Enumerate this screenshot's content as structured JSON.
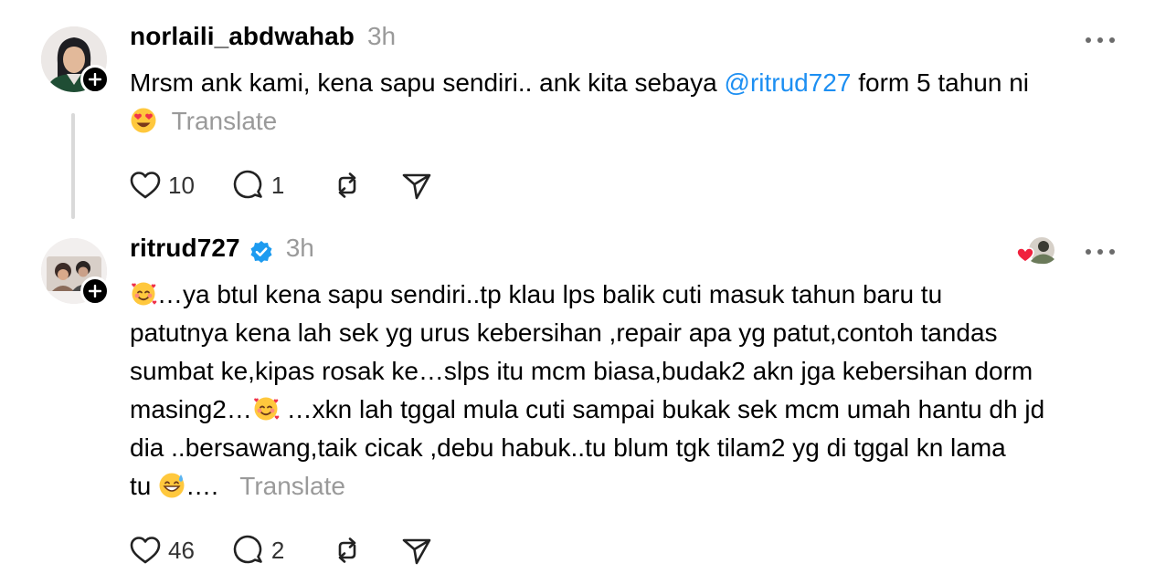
{
  "posts": [
    {
      "username": "norlaili_abdwahab",
      "time": "3h",
      "text_before_mention": "Mrsm ank kami, kena sapu sendiri.. ank kita sebaya ",
      "mention": "@ritrud727",
      "text_after_mention": " form 5 tahun ni",
      "emoji_icon": "heart-eyes-emoji",
      "translate_label": "Translate",
      "likes": "10",
      "replies": "1"
    },
    {
      "username": "ritrud727",
      "verified": true,
      "time": "3h",
      "line1": "…ya btul kena sapu sendiri..tp klau lps balik cuti masuk tahun baru tu",
      "line2": "patutnya kena lah sek yg urus kebersihan ,repair apa yg patut,contoh tandas",
      "line3": "sumbat ke,kipas rosak ke…slps itu mcm biasa,budak2 akn jga kebersihan dorm",
      "line4_a": "masing2…",
      "line4_b": " …xkn lah tggal mula cuti sampai bukak sek mcm umah hantu dh jd",
      "line5": "dia ..bersawang,taik cicak ,debu habuk..tu blum tgk tilam2 yg di tggal kn lama",
      "line6_a": "tu ",
      "line6_b": "….",
      "translate_label": "Translate",
      "likes": "46",
      "replies": "2"
    }
  ],
  "colors": {
    "mention": "#1d8ff2",
    "muted": "#9a9a9a",
    "verified": "#1d9bf0",
    "thread_line": "#d9d9d9"
  }
}
